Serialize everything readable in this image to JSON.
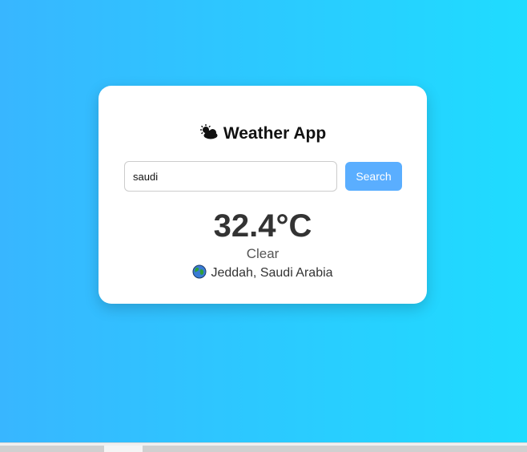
{
  "app": {
    "title": "Weather App",
    "title_icon": "sun-behind-cloud-icon"
  },
  "search": {
    "value": "saudi",
    "button_label": "Search"
  },
  "weather": {
    "temperature": "32.4°C",
    "condition": "Clear",
    "location": "Jeddah, Saudi Arabia",
    "location_icon": "globe-icon"
  },
  "colors": {
    "background_start": "#38b6ff",
    "background_end": "#1fdcff",
    "button": "#5aaeff"
  }
}
